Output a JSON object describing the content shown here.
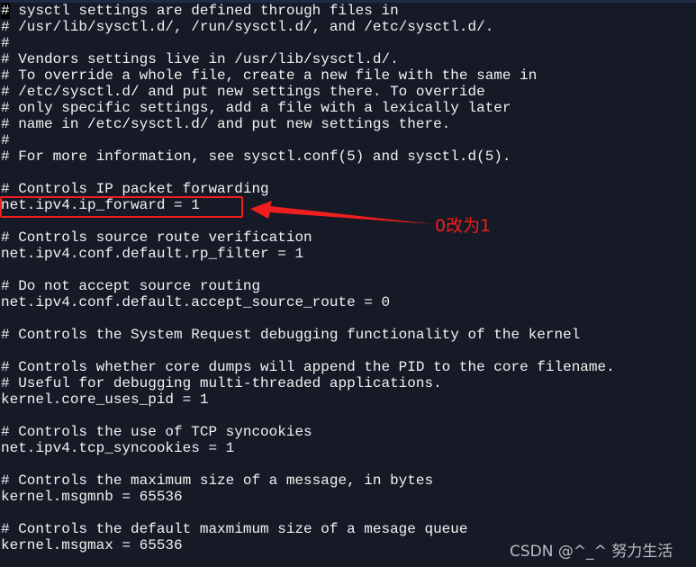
{
  "terminal": {
    "lines": [
      "# sysctl settings are defined through files in",
      "# /usr/lib/sysctl.d/, /run/sysctl.d/, and /etc/sysctl.d/.",
      "#",
      "# Vendors settings live in /usr/lib/sysctl.d/.",
      "# To override a whole file, create a new file with the same in",
      "# /etc/sysctl.d/ and put new settings there. To override",
      "# only specific settings, add a file with a lexically later",
      "# name in /etc/sysctl.d/ and put new settings there.",
      "#",
      "# For more information, see sysctl.conf(5) and sysctl.d(5).",
      "",
      "# Controls IP packet forwarding",
      "net.ipv4.ip_forward = 1",
      "",
      "# Controls source route verification",
      "net.ipv4.conf.default.rp_filter = 1",
      "",
      "# Do not accept source routing",
      "net.ipv4.conf.default.accept_source_route = 0",
      "",
      "# Controls the System Request debugging functionality of the kernel",
      "",
      "# Controls whether core dumps will append the PID to the core filename.",
      "# Useful for debugging multi-threaded applications.",
      "kernel.core_uses_pid = 1",
      "",
      "# Controls the use of TCP syncookies",
      "net.ipv4.tcp_syncookies = 1",
      "",
      "# Controls the maximum size of a message, in bytes",
      "kernel.msgmnb = 65536",
      "",
      "# Controls the default maxmimum size of a mesage queue",
      "kernel.msgmax = 65536"
    ]
  },
  "annotation": {
    "text": "0改为1",
    "color": "#f21c1c"
  },
  "watermark": "CSDN @^_^ 努力生活"
}
